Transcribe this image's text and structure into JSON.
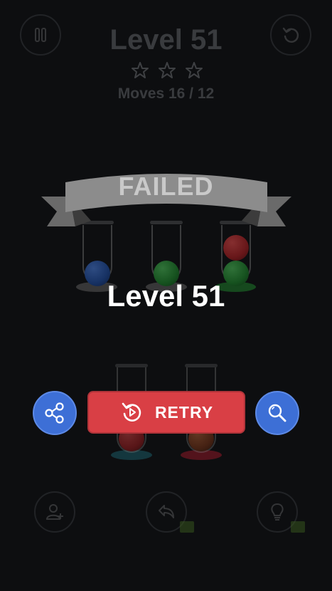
{
  "header": {
    "title": "Level 51",
    "moves_text": "Moves 16 / 12",
    "stars_earned": 0,
    "stars_total": 3
  },
  "dialog": {
    "banner_text": "FAILED",
    "level_text": "Level 51",
    "retry_label": "RETRY"
  },
  "colors": {
    "blue_ball": "#1f4fa8",
    "green_ball": "#1e8a2c",
    "red_ball": "#b31f22",
    "retry_button": "#d93f45",
    "circle_button": "#3d6fd6"
  },
  "icons": {
    "pause": "pause-icon",
    "restart": "restart-icon",
    "share": "share-icon",
    "search": "magnifier-icon",
    "add_user": "add-user-icon",
    "undo": "undo-icon",
    "hint": "lightbulb-icon",
    "video": "video-icon"
  }
}
